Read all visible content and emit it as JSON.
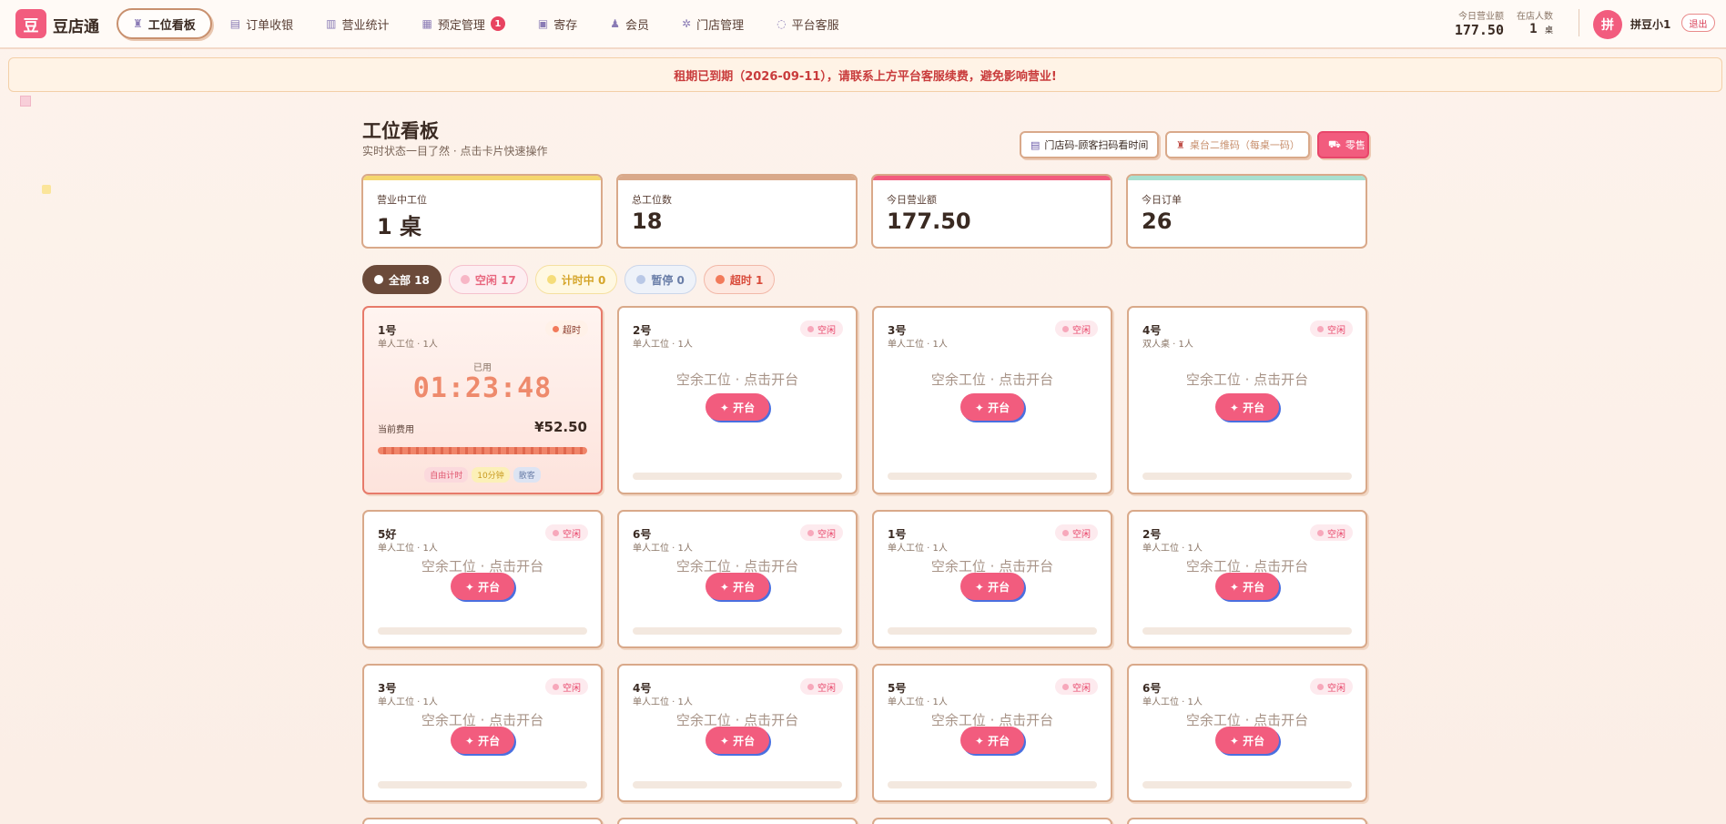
{
  "app": {
    "logo_char": "豆",
    "name": "豆店通"
  },
  "nav": [
    {
      "icon": "♜",
      "label": "工位看板",
      "active": true
    },
    {
      "icon": "▤",
      "label": "订单收银"
    },
    {
      "icon": "▥",
      "label": "营业统计"
    },
    {
      "icon": "▦",
      "label": "预定管理",
      "badge": "1"
    },
    {
      "icon": "▣",
      "label": "寄存"
    },
    {
      "icon": "♟",
      "label": "会员"
    },
    {
      "icon": "✲",
      "label": "门店管理"
    },
    {
      "icon": "◌",
      "label": "平台客服"
    }
  ],
  "header_stats": {
    "revenue_label": "今日营业额",
    "revenue_value": "177.50",
    "instore_label": "在店人数",
    "instore_value": "1",
    "instore_unit": "桌"
  },
  "user": {
    "avatar_char": "拼",
    "name": "拼豆小1",
    "logout": "退出"
  },
  "notice": "租期已到期（2026-09-11），请联系上方平台客服续费，避免影响营业!",
  "page": {
    "title": "工位看板",
    "subtitle": "实时状态一目了然 · 点击卡片快速操作"
  },
  "actions": {
    "store_code": "门店码-顾客扫码看时间",
    "table_qr": "桌台二维码（每桌一码）",
    "retail": "零售"
  },
  "kpis": [
    {
      "label": "营业中工位",
      "value": "1 桌",
      "accent": "#f5d76e"
    },
    {
      "label": "总工位数",
      "value": "18",
      "accent": "#d9a98a"
    },
    {
      "label": "今日营业额",
      "value": "177.50",
      "accent": "#f25c7e"
    },
    {
      "label": "今日订单",
      "value": "26",
      "accent": "#a8e0d0"
    }
  ],
  "filters": [
    {
      "label": "全部 18",
      "dot": "#ffffff",
      "bg": "#6b4a3a",
      "fg": "#ffffff",
      "border": "#6b4a3a"
    },
    {
      "label": "空闲 17",
      "dot": "#f7b6c6",
      "bg": "#fdeef1",
      "fg": "#e8667e",
      "border": "#f5c1cd"
    },
    {
      "label": "计时中 0",
      "dot": "#f5dd7a",
      "bg": "#fff8e2",
      "fg": "#d5a52a",
      "border": "#f5e0a0"
    },
    {
      "label": "暂停 0",
      "dot": "#b9c8e6",
      "bg": "#eef2f9",
      "fg": "#6a7ea8",
      "border": "#cbd6ea"
    },
    {
      "label": "超时 1",
      "dot": "#f27a5a",
      "bg": "#fde8e0",
      "fg": "#d94a3a",
      "border": "#f2b8a8"
    }
  ],
  "empty_text": "空余工位 · 点击开台",
  "open_label": "✦ 开台",
  "active_card": {
    "name": "1号",
    "meta": "单人工位 · 1人",
    "status": "超时",
    "used_label": "已用",
    "timer": "01:23:48",
    "fee_label": "当前费用",
    "fee": "¥52.50",
    "tags": [
      {
        "text": "自由计时",
        "bg": "#fbd9dd",
        "fg": "#e0566e"
      },
      {
        "text": "10分钟",
        "bg": "#fcf0b8",
        "fg": "#c89a20"
      },
      {
        "text": "散客",
        "bg": "#dde4f3",
        "fg": "#6a7ea8"
      }
    ]
  },
  "cards": [
    {
      "name": "2号",
      "meta": "单人工位 · 1人",
      "status": "空闲"
    },
    {
      "name": "3号",
      "meta": "单人工位 · 1人",
      "status": "空闲"
    },
    {
      "name": "4号",
      "meta": "双人桌 · 1人",
      "status": "空闲"
    },
    {
      "name": "5好",
      "meta": "单人工位 · 1人",
      "status": "空闲"
    },
    {
      "name": "6号",
      "meta": "单人工位 · 1人",
      "status": "空闲"
    },
    {
      "name": "1号",
      "meta": "单人工位 · 1人",
      "status": "空闲"
    },
    {
      "name": "2号",
      "meta": "单人工位 · 1人",
      "status": "空闲"
    },
    {
      "name": "3号",
      "meta": "单人工位 · 1人",
      "status": "空闲"
    },
    {
      "name": "4号",
      "meta": "单人工位 · 1人",
      "status": "空闲"
    },
    {
      "name": "5号",
      "meta": "单人工位 · 1人",
      "status": "空闲"
    },
    {
      "name": "6号",
      "meta": "单人工位 · 1人",
      "status": "空闲"
    }
  ]
}
